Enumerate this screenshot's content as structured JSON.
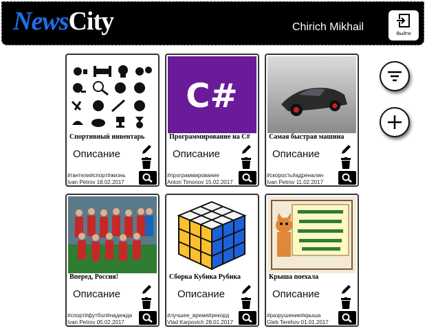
{
  "header": {
    "logo_part1": "News",
    "logo_part2": "City",
    "user_name": "Chirich Mikhail",
    "logout_label": "Выйти"
  },
  "cards": [
    {
      "title": "Спортивный инвентарь",
      "description": "Описание",
      "tags": "#гантели#спорт#жизнь",
      "author": "Ivan Petrov",
      "date": "18.02.2017",
      "image": "sports-equipment-icons"
    },
    {
      "title": "Программирование на С#",
      "description": "Описание",
      "tags": "#программирование",
      "author": "Anton Timonov",
      "date": "15.02.2017",
      "image": "csharp-logo"
    },
    {
      "title": "Самая быстрая машина",
      "description": "Описание",
      "tags": "#скорость#адреналин",
      "author": "Ivan Petrov",
      "date": "11.02.2017",
      "image": "sports-car-photo"
    },
    {
      "title": "Вперед, Россия!",
      "description": "Описание",
      "tags": "#спорт#футбол#надежда",
      "author": "Ivan Petrov",
      "date": "05.02.2017",
      "image": "football-team-photo"
    },
    {
      "title": "Сборка Кубика Рубика",
      "description": "Описание",
      "tags": "#лучшее_время#рекорд",
      "author": "Vlad Karpovich",
      "date": "28.01.2017",
      "image": "rubiks-cube"
    },
    {
      "title": "Крыша поехала",
      "description": "Описание",
      "tags": "#разрушение#крыша",
      "author": "Gleb Terehov",
      "date": "01.01.2017",
      "image": "cartoon-cat-sign"
    }
  ],
  "colors": {
    "logo_accent": "#1e6fe8",
    "header_bg": "#000000",
    "csharp_purple": "#6a1b9a"
  }
}
